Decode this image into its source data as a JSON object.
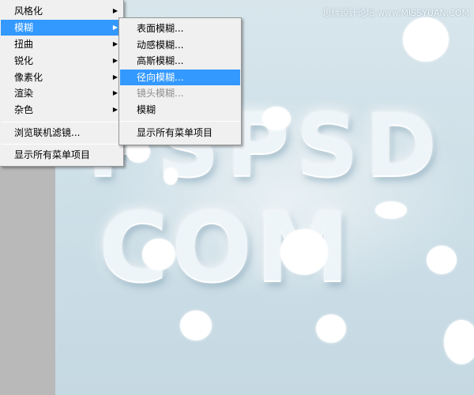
{
  "canvas": {
    "text_line_1": "PSPSD",
    "text_line_2": "COM"
  },
  "watermark": "思缘设计论坛 www.MISSYUAN.COM",
  "main_menu": {
    "items": [
      {
        "label": "风格化",
        "has_submenu": true
      },
      {
        "label": "模糊",
        "has_submenu": true,
        "state": "highlighted"
      },
      {
        "label": "扭曲",
        "has_submenu": true
      },
      {
        "label": "锐化",
        "has_submenu": true
      },
      {
        "label": "像素化",
        "has_submenu": true
      },
      {
        "label": "渲染",
        "has_submenu": true
      },
      {
        "label": "杂色",
        "has_submenu": true
      }
    ],
    "browse_label": "浏览联机滤镜...",
    "show_all_label": "显示所有菜单项目",
    "submenu_arrow": "▶"
  },
  "blur_submenu": {
    "items": [
      {
        "label": "表面模糊...",
        "state": "normal"
      },
      {
        "label": "动感模糊...",
        "state": "normal"
      },
      {
        "label": "高斯模糊...",
        "state": "normal"
      },
      {
        "label": "径向模糊...",
        "state": "highlighted"
      },
      {
        "label": "镜头模糊...",
        "state": "disabled"
      },
      {
        "label": "模糊",
        "state": "normal"
      }
    ],
    "show_all_label": "显示所有菜单项目"
  },
  "colors": {
    "menu_bg": "#f0f0f0",
    "highlight": "#3399ff",
    "disabled_text": "#8f8f8f",
    "canvas_bg": "#cfe0e8"
  }
}
